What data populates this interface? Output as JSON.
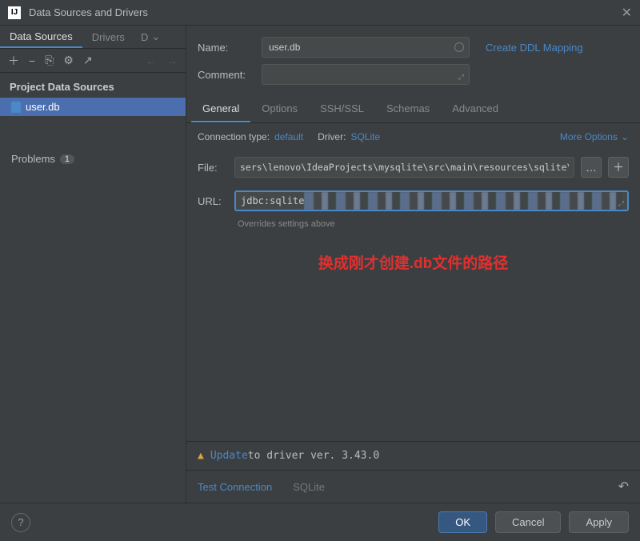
{
  "window": {
    "title": "Data Sources and Drivers"
  },
  "sidebar": {
    "tabs": {
      "sources": "Data Sources",
      "drivers": "Drivers",
      "more": "D"
    },
    "sectionHeader": "Project Data Sources",
    "item": "user.db",
    "problems": "Problems",
    "problemsCount": "1"
  },
  "form": {
    "nameLabel": "Name:",
    "nameValue": "user.db",
    "commentLabel": "Comment:",
    "ddlLink": "Create DDL Mapping"
  },
  "innerTabs": {
    "general": "General",
    "options": "Options",
    "ssh": "SSH/SSL",
    "schemas": "Schemas",
    "advanced": "Advanced"
  },
  "conn": {
    "typeLabel": "Connection type:",
    "typeValue": "default",
    "driverLabel": "Driver:",
    "driverValue": "SQLite",
    "moreOptions": "More Options"
  },
  "file": {
    "label": "File:",
    "value": "sers\\lenovo\\IdeaProjects\\mysqlite\\src\\main\\resources\\sqlite\\user.db"
  },
  "url": {
    "label": "URL:",
    "prefix": "jdbc:sqlite",
    "hint": "Overrides settings above"
  },
  "annotation": "换成刚才创建.db文件的路径",
  "updateBar": {
    "link": "Update",
    "rest": " to driver ver. 3.43.0"
  },
  "testBar": {
    "test": "Test Connection",
    "driver": "SQLite"
  },
  "footer": {
    "ok": "OK",
    "cancel": "Cancel",
    "apply": "Apply"
  }
}
